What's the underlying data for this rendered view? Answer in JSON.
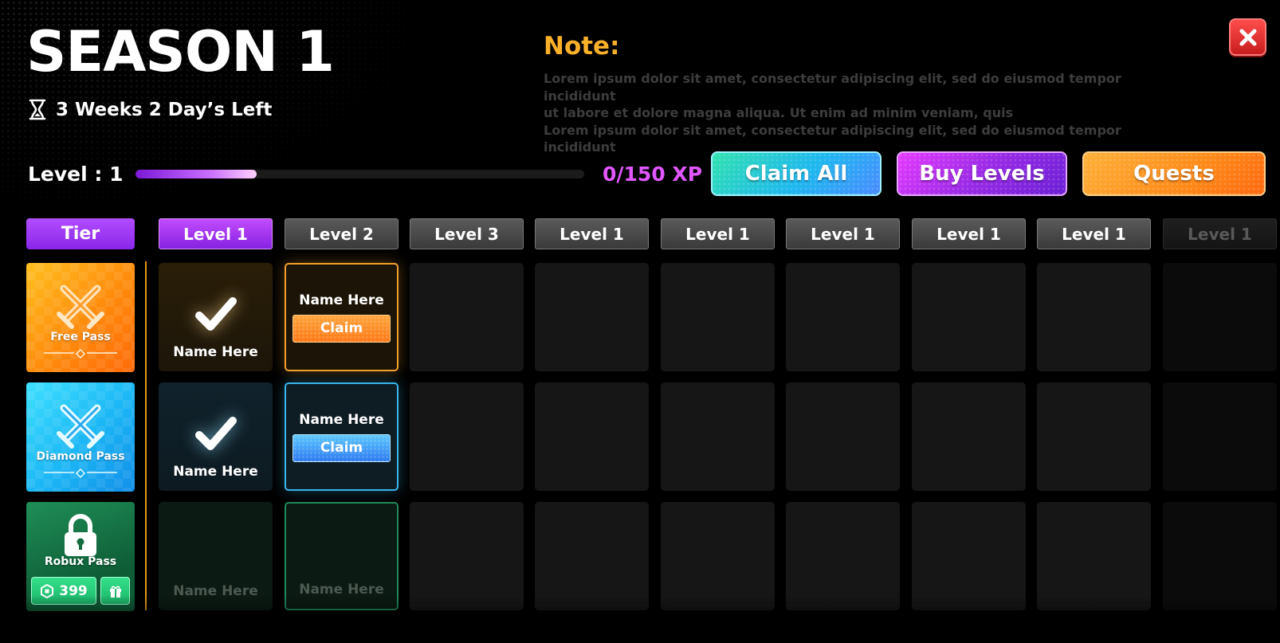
{
  "season": {
    "title": "SEASON 1",
    "time_left": "3 Weeks 2 Day’s Left"
  },
  "note": {
    "title": "Note:",
    "lines": [
      "Lorem ipsum dolor sit amet, consectetur adipiscing elit, sed do eiusmod tempor incididunt",
      "ut labore et dolore magna aliqua. Ut enim ad minim veniam, quis",
      "Lorem ipsum dolor sit amet, consectetur adipiscing elit, sed do eiusmod tempor incididunt"
    ]
  },
  "progress": {
    "level_label": "Level : 1",
    "xp_text": "0/150 XP",
    "fill_fraction": 0.27
  },
  "buttons": {
    "claim_all": "Claim All",
    "buy_levels": "Buy Levels",
    "quests": "Quests"
  },
  "tier_header": "Tier",
  "tiers": [
    {
      "name": "Free Pass"
    },
    {
      "name": "Diamond Pass"
    },
    {
      "name": "Robux Pass",
      "price": "399"
    }
  ],
  "levels": [
    "Level 1",
    "Level 2",
    "Level 3",
    "Level 1",
    "Level 1",
    "Level 1",
    "Level 1",
    "Level 1",
    "Level 1"
  ],
  "rewards": {
    "item_name": "Name Here",
    "claim_label": "Claim"
  },
  "colors": {
    "accent_orange": "#fbb02a",
    "xp_purple": "#e257ff",
    "close_red": "#e02a2a"
  }
}
